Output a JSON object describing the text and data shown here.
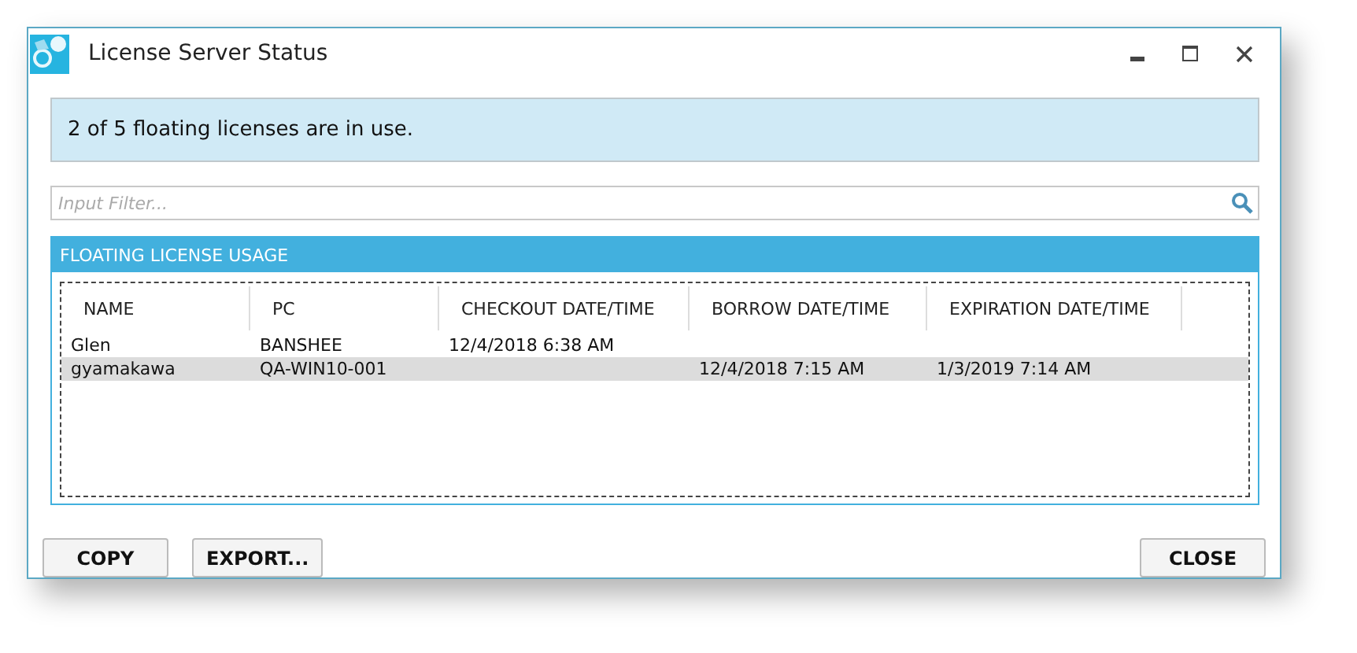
{
  "window": {
    "title": "License Server Status"
  },
  "status_message": "2 of 5 floating licenses are in use.",
  "filter": {
    "placeholder": "Input Filter..."
  },
  "panel": {
    "title": "FLOATING LICENSE USAGE"
  },
  "table": {
    "columns": [
      "NAME",
      "PC",
      "CHECKOUT DATE/TIME",
      "BORROW DATE/TIME",
      "EXPIRATION DATE/TIME"
    ],
    "rows": [
      {
        "cells": [
          "Glen",
          "BANSHEE",
          "12/4/2018 6:38 AM",
          "",
          ""
        ],
        "selected": false
      },
      {
        "cells": [
          "gyamakawa",
          "QA-WIN10-001",
          "",
          "12/4/2018 7:15 AM",
          "1/3/2019 7:14 AM"
        ],
        "selected": true
      }
    ]
  },
  "left_buttons": [
    "COPY",
    "EXPORT..."
  ],
  "right_buttons": [
    "CLOSE"
  ]
}
